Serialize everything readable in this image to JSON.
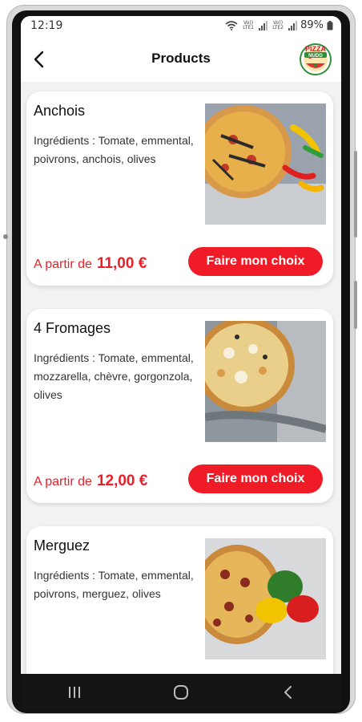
{
  "status_bar": {
    "time": "12:19",
    "sim1": "Vo)) LTE1",
    "sim2": "Vo)) LTE2",
    "battery": "89%"
  },
  "header": {
    "title": "Products",
    "logo_text_top": "PIZZA",
    "logo_text_bottom": "NUDO"
  },
  "products": [
    {
      "name": "Anchois",
      "ingredients": "Ingrédients : Tomate, emmental, poivrons, anchois, olives",
      "price_prefix": "A partir de",
      "price": "11,00 €",
      "button": "Faire mon choix"
    },
    {
      "name": "4 Fromages",
      "ingredients": "Ingrédients : Tomate, emmental, mozzarella, chèvre, gorgonzola, olives",
      "price_prefix": "A partir de",
      "price": "12,00 €",
      "button": "Faire mon choix"
    },
    {
      "name": "Merguez",
      "ingredients": "Ingrédients : Tomate, emmental, poivrons, merguez, olives",
      "price_prefix": "",
      "price": "",
      "button": ""
    }
  ],
  "colors": {
    "accent": "#ef1b26",
    "price_text": "#e8202a",
    "background": "#f2f2f2"
  },
  "navigation": [
    "recent-apps-icon",
    "home-icon",
    "back-icon"
  ]
}
